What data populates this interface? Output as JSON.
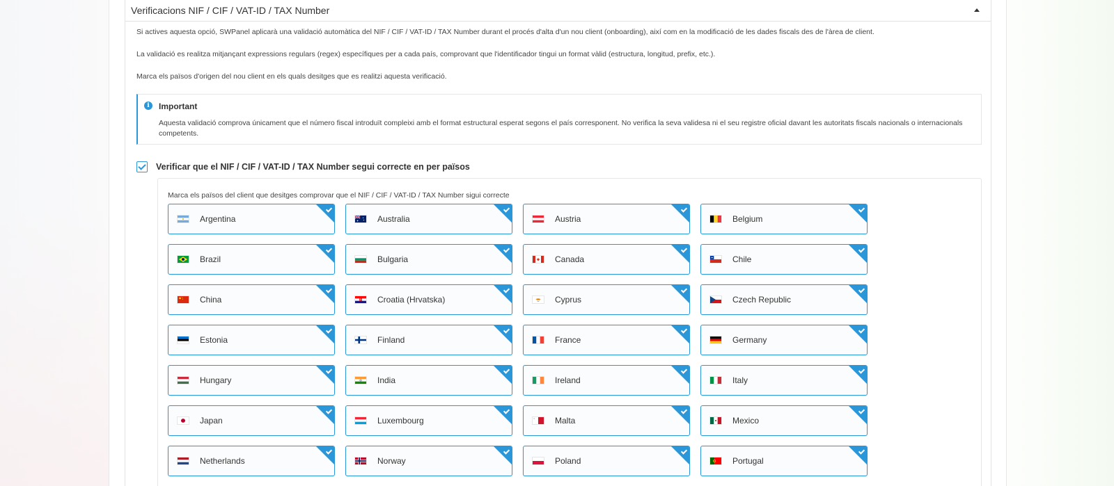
{
  "section": {
    "title": "Verificacions NIF / CIF / VAT-ID / TAX Number",
    "paragraphs": [
      "Si actives aquesta opció, SWPanel aplicarà una validació automàtica del NIF / CIF / VAT-ID / TAX Number durant el procés d'alta d'un nou client (onboarding), així com en la modificació de les dades fiscals des de l'àrea de client.",
      "La validació es realitza mitjançant expressions regulars (regex) específiques per a cada país, comprovant que l'identificador tingui un format vàlid (estructura, longitud, prefix, etc.).",
      "Marca els països d'origen del nou client en els quals desitges que es realitzi aquesta verificació."
    ]
  },
  "alert": {
    "icon": "info-icon",
    "title": "Important",
    "text": "Aquesta validació comprova únicament que el número fiscal introduït compleixi amb el format estructural esperat segons el país corresponent. No verifica la seva validesa ni el seu registre oficial davant les autoritats fiscals nacionals o internacionals competents."
  },
  "verify": {
    "checked": true,
    "label": "Verificar que el NIF / CIF / VAT-ID / TAX Number segui correcte en per països",
    "panel_label": "Marca els països del client que desitges comprovar que el NIF / CIF / VAT-ID / TAX Number sigui correcte"
  },
  "countries": [
    {
      "name": "Argentina",
      "flag": "ar",
      "selected": true
    },
    {
      "name": "Australia",
      "flag": "au",
      "selected": true
    },
    {
      "name": "Austria",
      "flag": "at",
      "selected": true
    },
    {
      "name": "Belgium",
      "flag": "be",
      "selected": true
    },
    {
      "name": "Brazil",
      "flag": "br",
      "selected": true
    },
    {
      "name": "Bulgaria",
      "flag": "bg",
      "selected": true
    },
    {
      "name": "Canada",
      "flag": "ca",
      "selected": true
    },
    {
      "name": "Chile",
      "flag": "cl",
      "selected": true
    },
    {
      "name": "China",
      "flag": "cn",
      "selected": true
    },
    {
      "name": "Croatia (Hrvatska)",
      "flag": "hr",
      "selected": true
    },
    {
      "name": "Cyprus",
      "flag": "cy",
      "selected": true
    },
    {
      "name": "Czech Republic",
      "flag": "cz",
      "selected": true
    },
    {
      "name": "Estonia",
      "flag": "ee",
      "selected": true
    },
    {
      "name": "Finland",
      "flag": "fi",
      "selected": true
    },
    {
      "name": "France",
      "flag": "fr",
      "selected": true
    },
    {
      "name": "Germany",
      "flag": "de",
      "selected": true
    },
    {
      "name": "Hungary",
      "flag": "hu",
      "selected": true
    },
    {
      "name": "India",
      "flag": "in",
      "selected": true
    },
    {
      "name": "Ireland",
      "flag": "ie",
      "selected": true
    },
    {
      "name": "Italy",
      "flag": "it",
      "selected": true
    },
    {
      "name": "Japan",
      "flag": "jp",
      "selected": true
    },
    {
      "name": "Luxembourg",
      "flag": "lu",
      "selected": true
    },
    {
      "name": "Malta",
      "flag": "mt",
      "selected": true
    },
    {
      "name": "Mexico",
      "flag": "mx",
      "selected": true
    },
    {
      "name": "Netherlands",
      "flag": "nl",
      "selected": true
    },
    {
      "name": "Norway",
      "flag": "no",
      "selected": true
    },
    {
      "name": "Poland",
      "flag": "pl",
      "selected": true
    },
    {
      "name": "Portugal",
      "flag": "pt",
      "selected": true
    }
  ],
  "colors": {
    "accent": "#2b97d8",
    "text": "#333333"
  }
}
